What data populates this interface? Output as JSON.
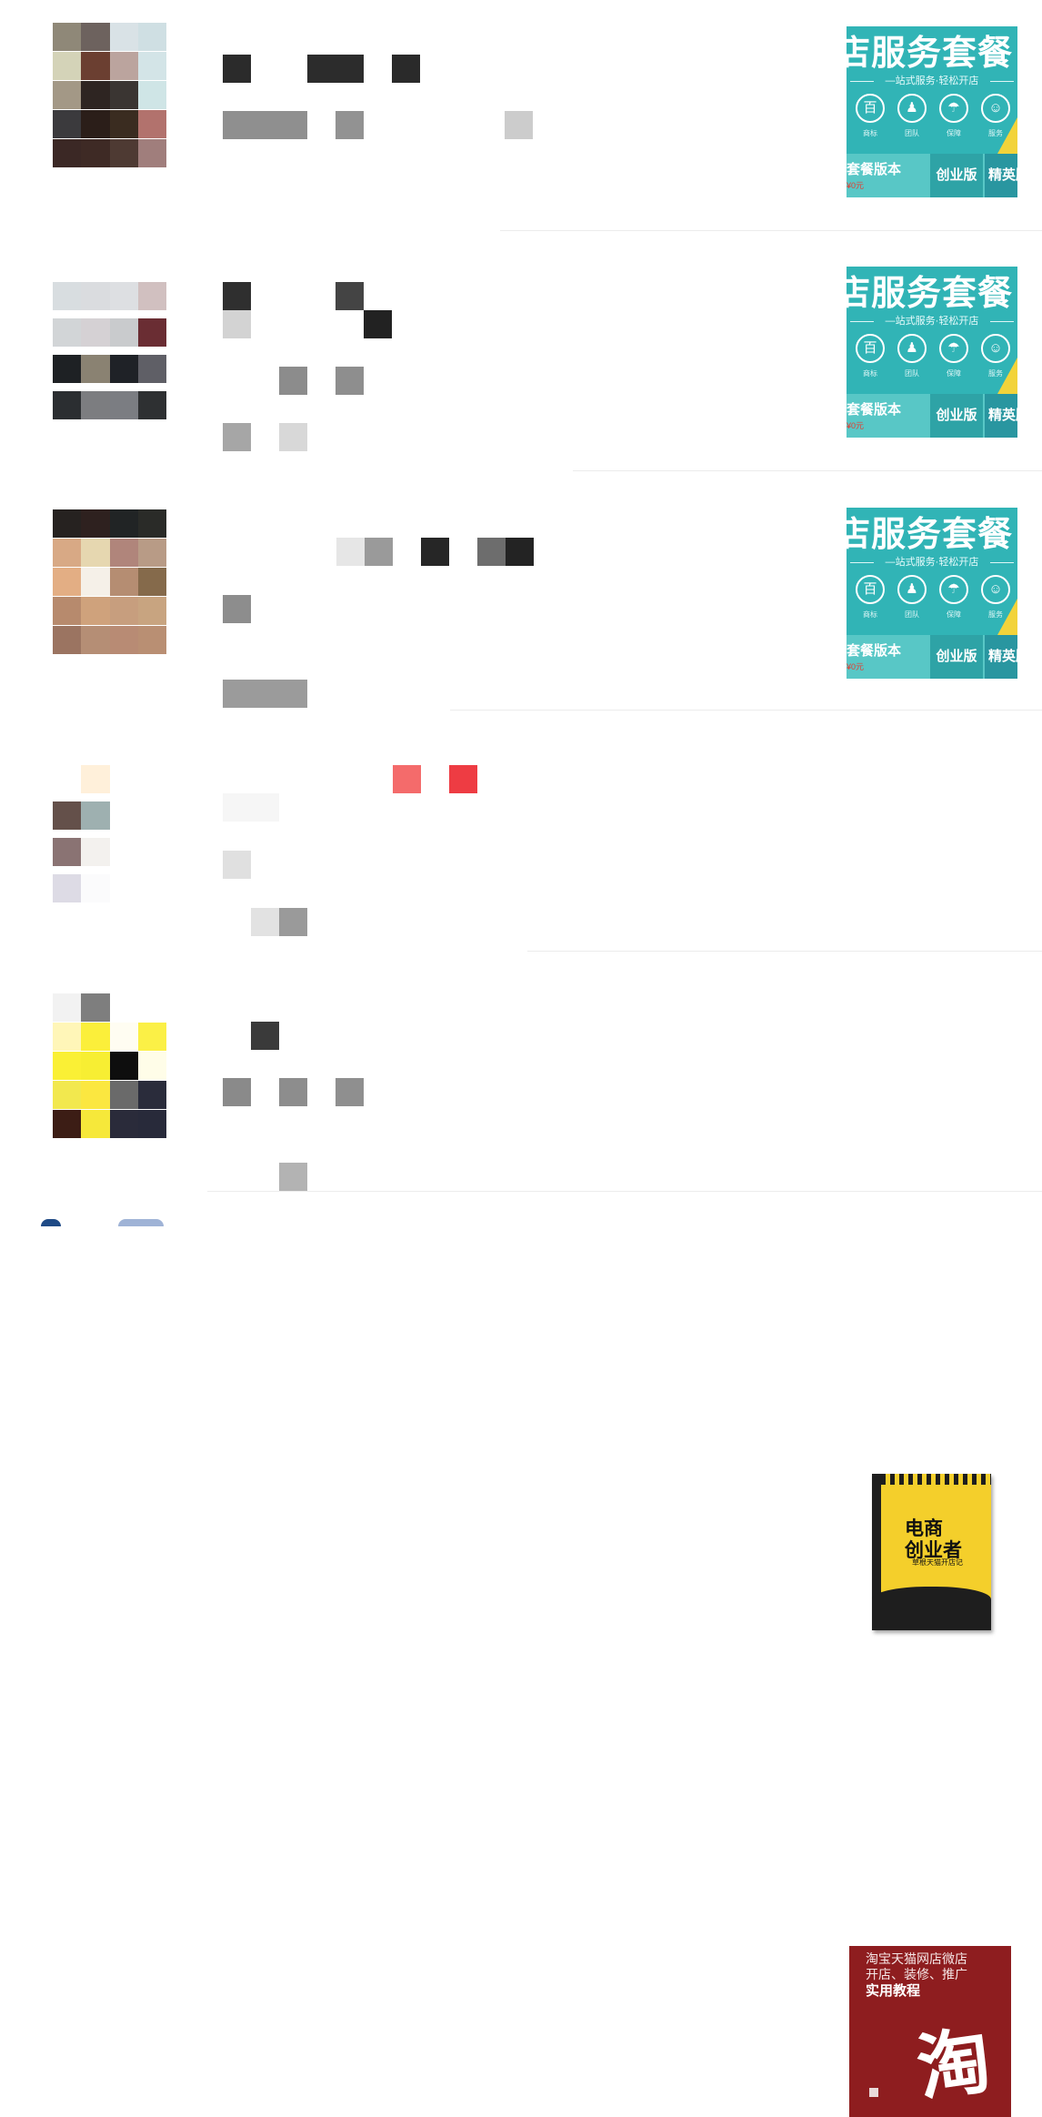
{
  "feed": {
    "items": [
      {
        "avatar": [
          "#8f8878",
          "#6d625e",
          "#d9e2e6",
          "#cfdfe3",
          "#d4d3b8",
          "#6b3f31",
          "#bba49e",
          "#d3e4e7",
          "#a39886",
          "#2e2522",
          "#3a3532",
          "#cfe5e6",
          "#3b3a3d",
          "#2b1e19",
          "#3a2c20",
          "#b2726d",
          "#3b2825",
          "#3e2a25",
          "#4e3a33",
          "#a07e7c"
        ],
        "blurred_text_color": "#2c2c2c",
        "thumbnail": "shop-service-promo"
      },
      {
        "avatar": [
          "#d8dde0",
          "#dadcdf",
          "#dddfe2",
          "#d1c0c0",
          "#d2d5d7",
          "#d5d1d4",
          "#c9cbcd",
          "#6a2d33",
          "#1e2124",
          "#8a8272",
          "#1f2227",
          "#5f5f66",
          "#2b2e31",
          "#7c7d80",
          "#7b7d82",
          "#2e3032"
        ],
        "blurred_text_color": "#333333",
        "thumbnail": "shop-service-promo"
      },
      {
        "avatar": [
          "#262220",
          "#2e211f",
          "#212425",
          "#2a2b28",
          "#d8a985",
          "#e6d7b0",
          "#b0857b",
          "#b89b86",
          "#e3ae84",
          "#f5f0e8",
          "#b58d72",
          "#856a4b",
          "#b78a6d",
          "#cfa27c",
          "#c79e7e",
          "#c8a480",
          "#9b7461",
          "#b58e75",
          "#b88b74",
          "#b98f73"
        ],
        "blurred_text_color": "#2e2e2e",
        "thumbnail": "shop-service-promo"
      },
      {
        "avatar": [
          "#ffffff",
          "#fff0da",
          "#ffffff",
          "#ffffff",
          "#64504a",
          "#9eb0b0",
          "#ffffff",
          "#ffffff",
          "#8a7373",
          "#f3f1ee",
          "#ffffff",
          "#ffffff",
          "#dddbe5",
          "#fbfbfc",
          "#ffffff",
          "#ffffff"
        ],
        "blurred_text_color": "#f3f3f3",
        "thumbnail": "ecommerce-book"
      },
      {
        "avatar": [
          "#f2f2f2",
          "#7e7e7e",
          "#ffffff",
          "#ffffff",
          "#fff6b8",
          "#fbef3a",
          "#fffdf2",
          "#fbf046",
          "#faf035",
          "#f7ee33",
          "#0e0e0e",
          "#fffde8",
          "#f2e84e",
          "#fbe740",
          "#6a6a6a",
          "#2a2c3b",
          "#3c1d15",
          "#f6e83a",
          "#2a2b3a",
          "#282a3a"
        ],
        "blurred_text_color": "#3a3a3a",
        "thumbnail": "taobao-book"
      }
    ]
  },
  "promo": {
    "title": "店服务套餐",
    "subtitle": "—站式服务·轻松开店",
    "icons": [
      {
        "name": "logo-service-icon",
        "glyph": "百",
        "label": "商标"
      },
      {
        "name": "user-service-icon",
        "glyph": "♟",
        "label": "团队"
      },
      {
        "name": "umbrella-service-icon",
        "glyph": "☂",
        "label": "保障"
      },
      {
        "name": "support-service-icon",
        "glyph": "☺",
        "label": "服务"
      }
    ],
    "package_label": "套餐版本",
    "price_tag": "¥0元",
    "tab_startup": "创业版",
    "tab_elite": "精英版",
    "colors": {
      "teal": "#31b4b6",
      "band": "#58c7c6",
      "accent": "#f2d33a"
    }
  },
  "book_yellow": {
    "title_line1": "电商",
    "title_line2": "创业者",
    "subtitle": "草根天猫开店记"
  },
  "book_red": {
    "line1": "淘宝天猫网店微店",
    "line2": "开店、装修、推广",
    "line3": "实用教程",
    "glyph": "淘"
  }
}
